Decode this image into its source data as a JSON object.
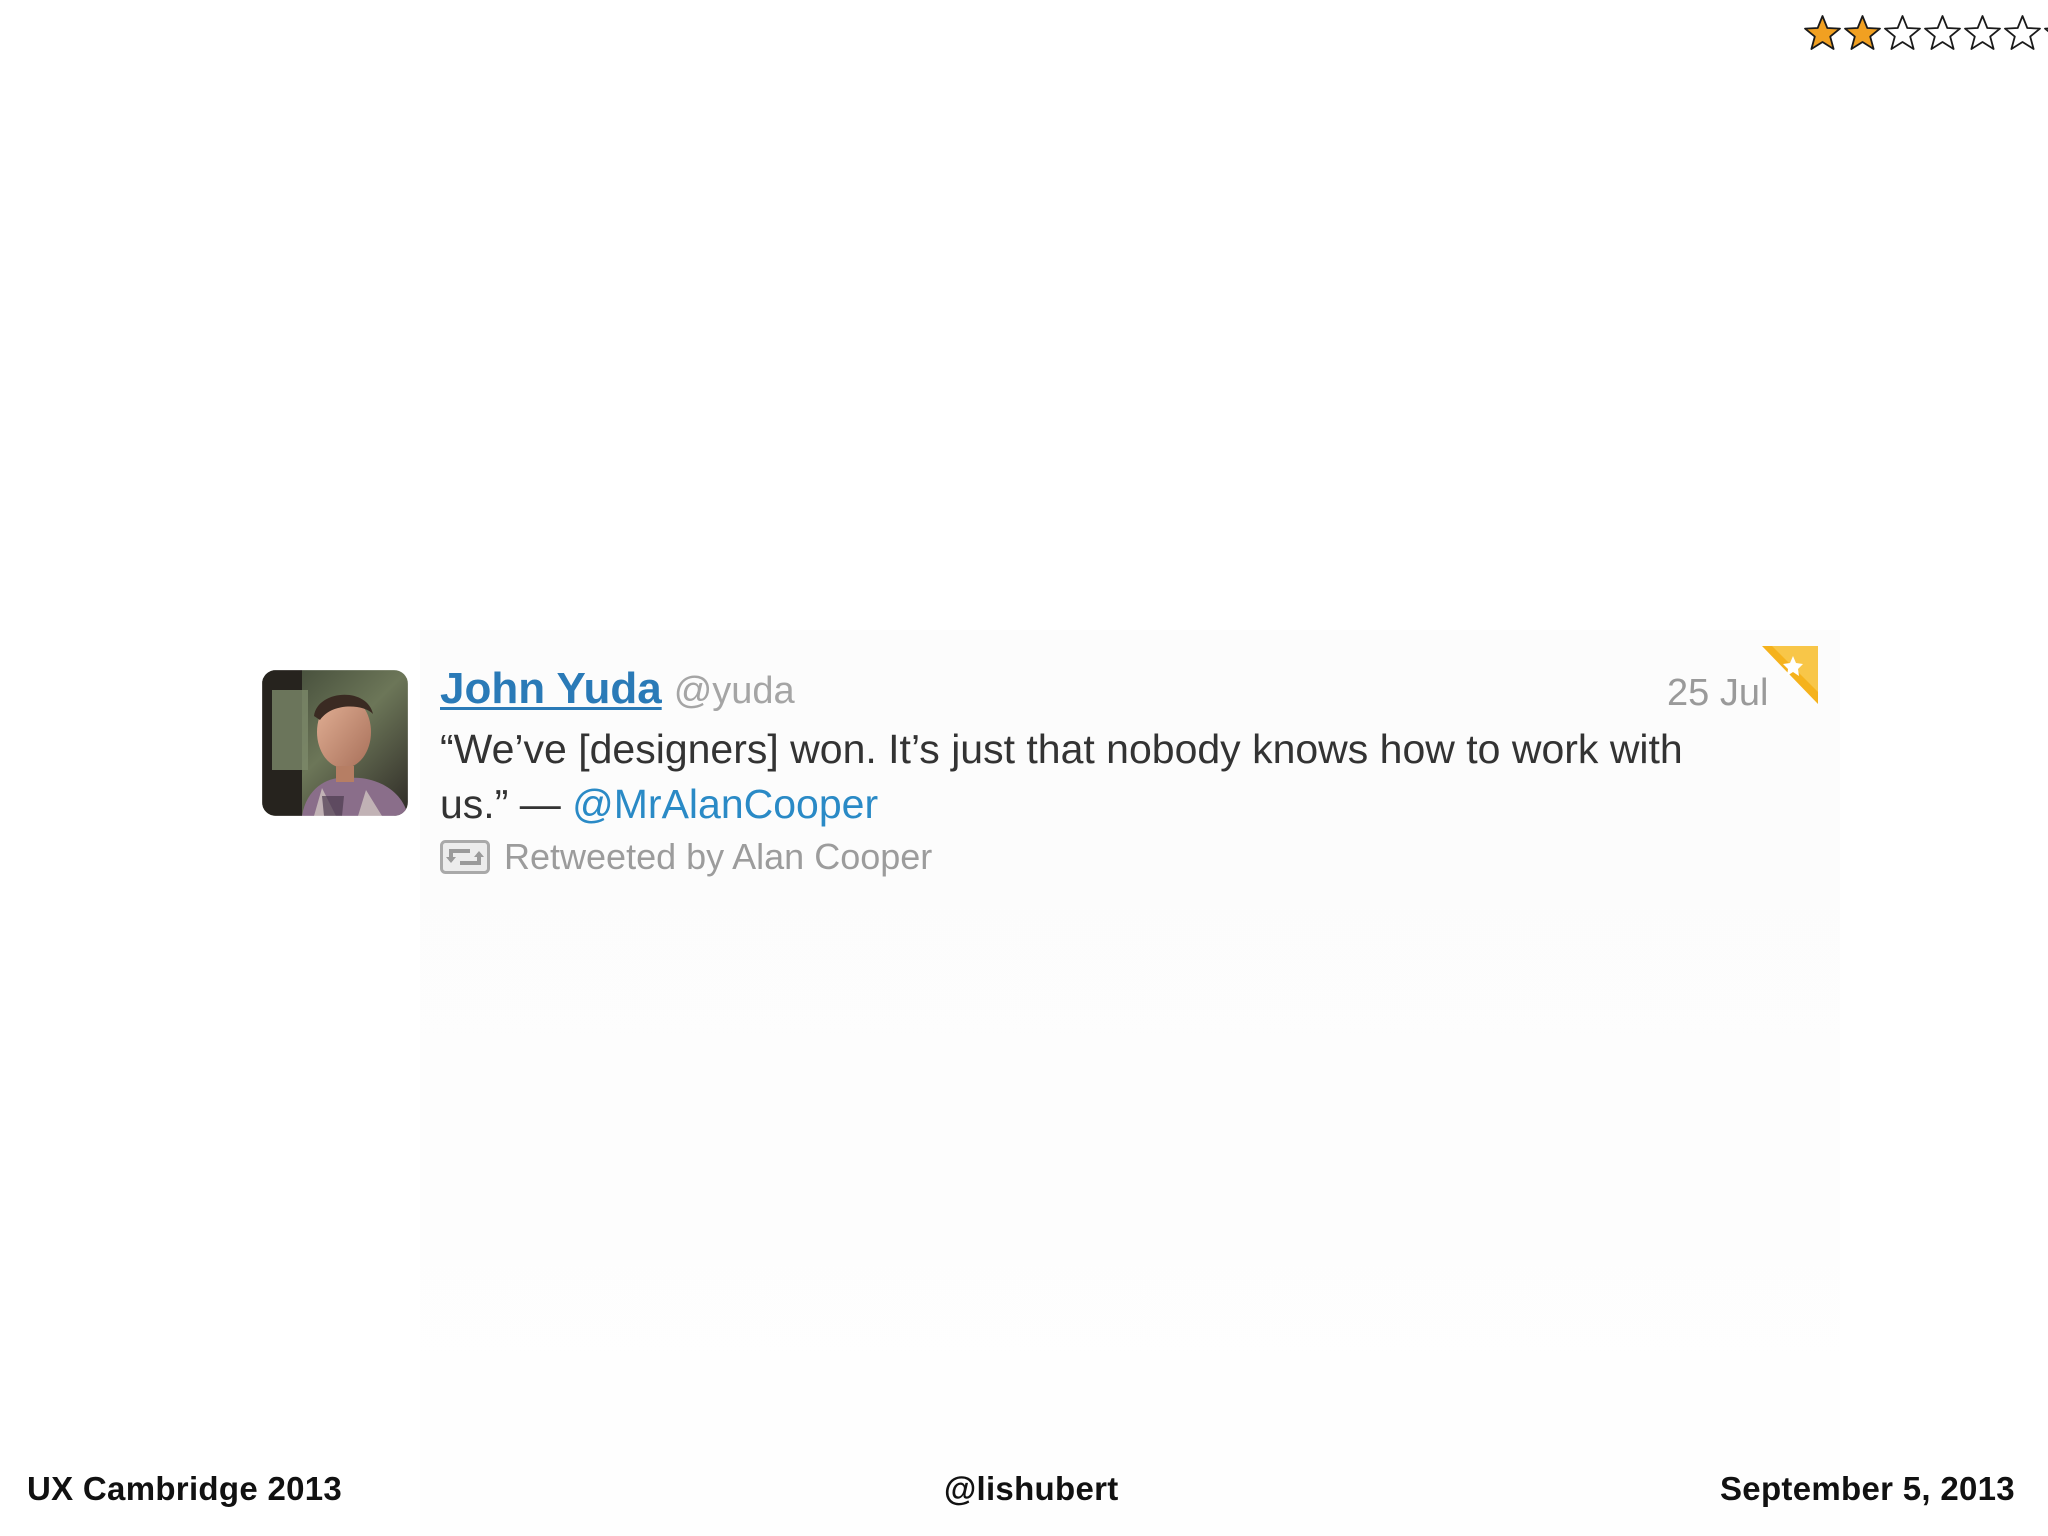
{
  "slide": {
    "background": "#ffffff"
  },
  "rating": {
    "value": 2,
    "max": 7,
    "filled_color": "#f1a021",
    "empty_color": "#ffffff",
    "icon": "star-icon"
  },
  "tweet": {
    "author_name": "John Yuda",
    "author_handle": "@yuda",
    "time": "25 Jul",
    "text_prefix": "“We’ve [designers] won. It’s just that nobody knows how to work with us.” — ",
    "mention": "@MrAlanCooper",
    "retweet_label": "Retweeted by Alan Cooper",
    "colors": {
      "name_link": "#2a7ab7",
      "mention_link": "#2a8ac6",
      "body_text": "#333333",
      "meta_text": "#9c9c9c",
      "favorite_accent": "#f5b21c"
    },
    "icons": {
      "avatar": "avatar-photo",
      "retweet": "retweet-icon",
      "favorite": "favorite-corner-icon"
    }
  },
  "footer": {
    "left": "UX Cambridge 2013",
    "center": "@lishubert",
    "right": "September 5, 2013"
  }
}
